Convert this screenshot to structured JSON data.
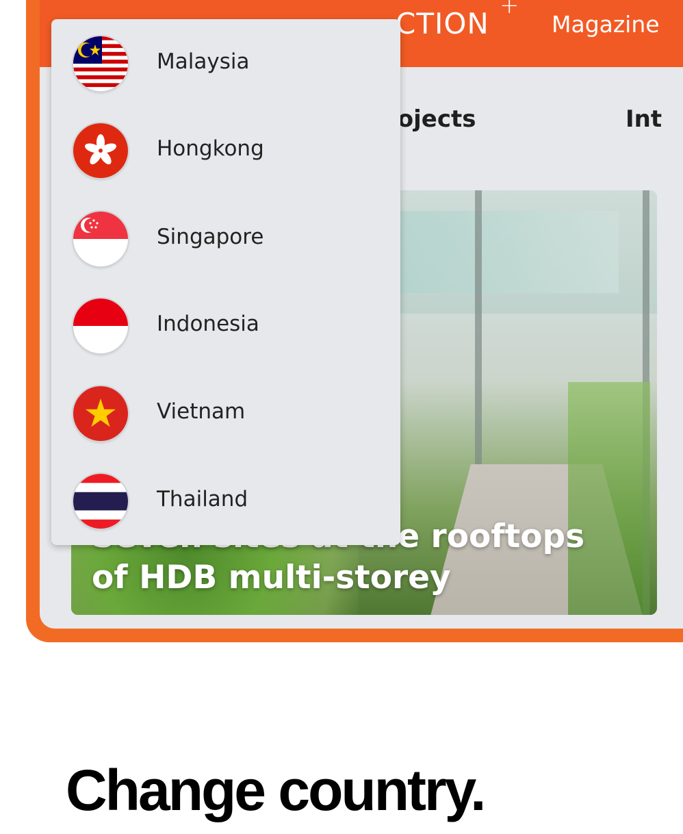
{
  "header": {
    "logo_text": "CTION",
    "logo_plus": "+",
    "nav_magazine": "Magazine"
  },
  "tabs": {
    "projects": "rojects",
    "int": "Int"
  },
  "article": {
    "title_line1": "Seven sites at the rooftops",
    "title_line2": "of HDB multi-storey"
  },
  "country_menu": {
    "items": [
      {
        "label": "Malaysia",
        "flag_icon": "malaysia-flag-icon"
      },
      {
        "label": "Hongkong",
        "flag_icon": "hongkong-flag-icon"
      },
      {
        "label": "Singapore",
        "flag_icon": "singapore-flag-icon"
      },
      {
        "label": "Indonesia",
        "flag_icon": "indonesia-flag-icon"
      },
      {
        "label": "Vietnam",
        "flag_icon": "vietnam-flag-icon"
      },
      {
        "label": "Thailand",
        "flag_icon": "thailand-flag-icon"
      }
    ]
  },
  "caption": {
    "headline": "Change country."
  },
  "colors": {
    "brand_orange": "#f15a24",
    "frame_orange": "#f26b25",
    "menu_background": "#e6e8eb"
  }
}
